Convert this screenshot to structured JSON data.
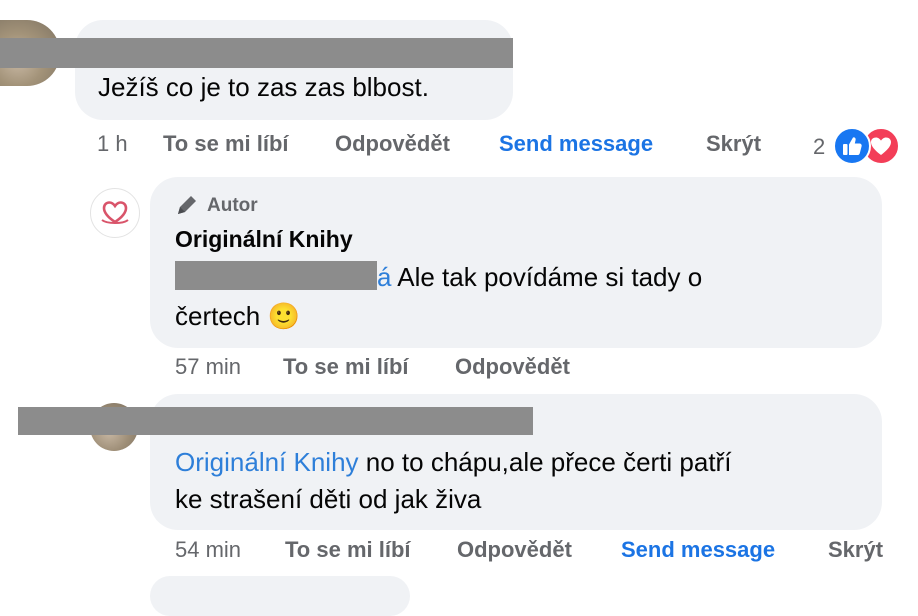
{
  "comments": [
    {
      "text": "Ježíš co je to zas zas blbost.",
      "actions": {
        "time": "1 h",
        "like": "To se mi líbí",
        "reply": "Odpovědět",
        "message": "Send message",
        "hide": "Skrýt"
      },
      "reactions": {
        "count": "2",
        "icons": [
          "like-icon",
          "love-icon"
        ]
      }
    },
    {
      "badge": "Autor",
      "author": "Originální Knihy",
      "mention_tail": "á",
      "line1": " Ale tak povídáme si tady o",
      "line2": "čertech ",
      "emoji": "🙂",
      "actions": {
        "time": "57 min",
        "like": "To se mi líbí",
        "reply": "Odpovědět"
      }
    },
    {
      "mention": "Originální Knihy",
      "line1": " no to chápu,ale přece čerti patří",
      "line2": "ke strašení děti od jak živa",
      "actions": {
        "time": "54 min",
        "like": "To se mi líbí",
        "reply": "Odpovědět",
        "message": "Send message",
        "hide": "Skrýt"
      }
    }
  ],
  "colors": {
    "bubble": "#f0f2f5",
    "link_blue": "#1b74e4",
    "meta_gray": "#65676b",
    "like_blue": "#1877f2",
    "love_red": "#f33e58"
  }
}
